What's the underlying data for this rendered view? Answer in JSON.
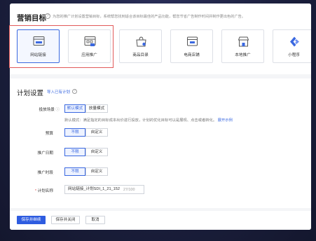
{
  "marketing": {
    "title": "营销目标",
    "description": "为您的推广计划设置营销目标，系统帮您找到适合该目标最佳的产品功能，帮您节省广告制作时间并制作更出色的广告。",
    "cards": [
      {
        "label": "网站链接",
        "icon": "website-link-icon",
        "selected": true
      },
      {
        "label": "应用推广",
        "icon": "app-promotion-icon",
        "selected": false
      },
      {
        "label": "商品目录",
        "icon": "product-catalog-icon",
        "selected": false
      },
      {
        "label": "电商店铺",
        "icon": "ecommerce-store-icon",
        "selected": false
      },
      {
        "label": "本地推广",
        "icon": "local-promotion-icon",
        "selected": false
      },
      {
        "label": "小程序",
        "icon": "mini-program-icon",
        "selected": false
      }
    ]
  },
  "plan": {
    "title": "计划设置",
    "import_link": "导入已有计划",
    "scene_label": "投放场景",
    "scene_options": [
      "默认模式",
      "放量模式"
    ],
    "scene_hint": "默认模式：满足指定的目标成本出价进行投放，计划的优化目标可以是展现、点击或者转化。",
    "scene_hint_link": "展开示例",
    "budget_label": "预算",
    "date_label": "推广日期",
    "time_label": "推广时段",
    "unlimited": "不限",
    "custom": "自定义",
    "name_label": "计划名称",
    "name_value": "网站链接_计划SDI_1_21_152",
    "name_counter": "27/100"
  },
  "footer": {
    "save_continue": "保存并继续",
    "save_close": "保存并关闭",
    "cancel": "取消"
  },
  "colors": {
    "accent": "#2e5ce0",
    "highlight_border": "#e25a5a"
  }
}
